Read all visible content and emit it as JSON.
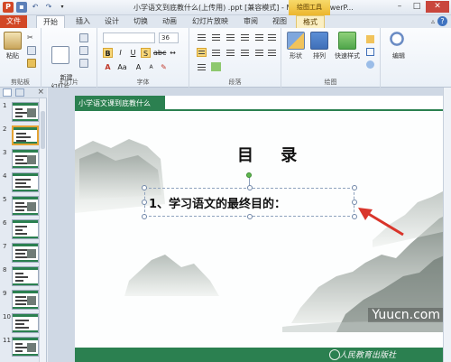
{
  "window": {
    "title": "小学语文到底教什么(上传用)  .ppt [兼容模式] - Microsoft PowerP...",
    "context_tab": "绘图工具"
  },
  "tabs": [
    {
      "label": "文件"
    },
    {
      "label": "开始"
    },
    {
      "label": "插入"
    },
    {
      "label": "设计"
    },
    {
      "label": "切换"
    },
    {
      "label": "动画"
    },
    {
      "label": "幻灯片放映"
    },
    {
      "label": "审阅"
    },
    {
      "label": "视图"
    },
    {
      "label": "格式"
    }
  ],
  "ribbon": {
    "clipboard": {
      "paste_label": "粘贴",
      "group_label": "剪贴板"
    },
    "slides": {
      "new_slide_label": "新建\n幻灯片",
      "group_label": "幻灯片"
    },
    "font": {
      "font_size": "36",
      "group_label": "字体"
    },
    "paragraph": {
      "group_label": "段落"
    },
    "drawing": {
      "shapes_label": "形状",
      "arrange_label": "排列",
      "quick_styles_label": "快速样式",
      "group_label": "绘图"
    },
    "editing": {
      "edit_label": "编辑"
    }
  },
  "slides_panel": {
    "thumbnails": [
      {
        "num": "1"
      },
      {
        "num": "2"
      },
      {
        "num": "3"
      },
      {
        "num": "4"
      },
      {
        "num": "5"
      },
      {
        "num": "6"
      },
      {
        "num": "7"
      },
      {
        "num": "8"
      },
      {
        "num": "9"
      },
      {
        "num": "10"
      },
      {
        "num": "11"
      }
    ],
    "selected_index": 2
  },
  "slide": {
    "header_tab": "小学语文课到底教什么",
    "title": "目 录",
    "item1": "1、学习语文的最终目的：",
    "footer_text": "人民教育出版社"
  },
  "watermark": "Yuucn.com",
  "colors": {
    "file_tab": "#d24726",
    "slide_green": "#2b8050",
    "context_tab": "#ecb62e",
    "arrow_red": "#d9352b"
  }
}
